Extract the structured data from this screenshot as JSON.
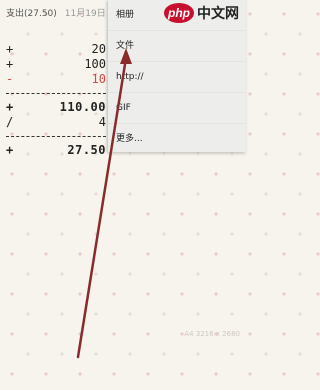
{
  "statusbar": {
    "title": "支出(27.50)",
    "date": "11月19日"
  },
  "calc": {
    "rows": [
      {
        "op": "+",
        "value": "20"
      },
      {
        "op": "+",
        "value": "100"
      },
      {
        "op": "-",
        "value": "10"
      }
    ],
    "subtotal": {
      "op": "+",
      "value": "110.00"
    },
    "divide": {
      "op": "/",
      "value": "4"
    },
    "total": {
      "op": "+",
      "value": "27.50"
    }
  },
  "menu": {
    "items": [
      "相册",
      "文件",
      "http://",
      "GIF",
      "更多..."
    ]
  },
  "logo": {
    "badge": "php",
    "text": "中文网"
  },
  "watermark": "A4 3216 x 2680"
}
